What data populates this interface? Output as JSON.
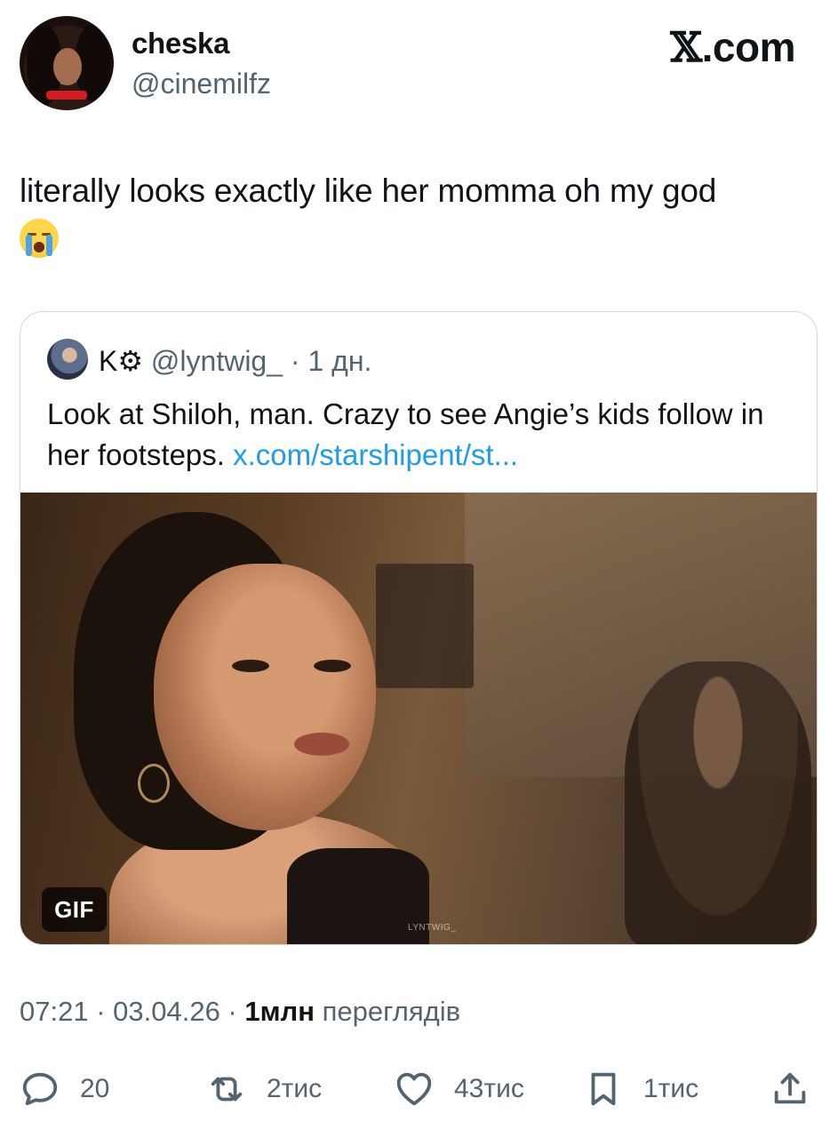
{
  "author": {
    "display_name": "cheska",
    "handle": "@cinemilfz"
  },
  "brand": {
    "x_glyph": "𝕏",
    "suffix": ".com"
  },
  "tweet": {
    "text": "literally looks exactly like her momma oh my god",
    "emoji": "loudly-crying-face"
  },
  "quoted": {
    "name": "K⚙",
    "handle": "@lyntwig_",
    "separator": " · ",
    "time": "1 дн.",
    "text": "Look at Shiloh, man. Crazy to see Angie’s kids follow in her footsteps. ",
    "link": "x.com/starshipent/st...",
    "media_badge": "GIF",
    "media_watermark": "LYNTWIG_"
  },
  "meta": {
    "time": "07:21",
    "date": "03.04.26",
    "views_count": "1млн",
    "views_label": "переглядів",
    "dot": " · "
  },
  "actions": {
    "replies": "20",
    "reposts": "2тис",
    "likes": "43тис",
    "bookmarks": "1тис"
  },
  "colors": {
    "text": "#0f1419",
    "secondary": "#536471",
    "link": "#1d9bf0",
    "border": "#cfd9de"
  }
}
